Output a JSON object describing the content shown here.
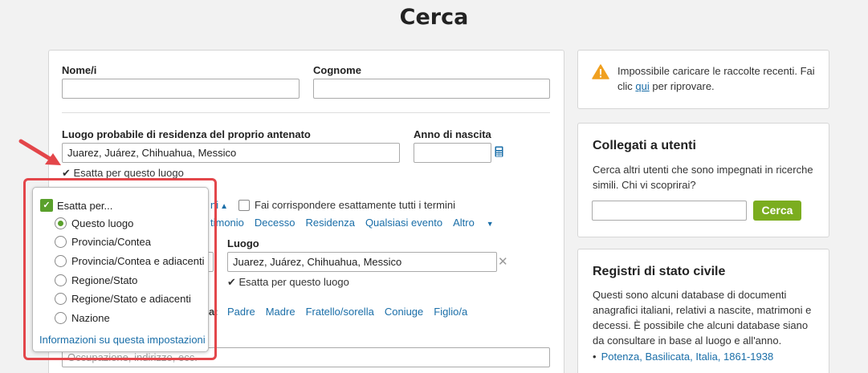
{
  "page": {
    "title": "Cerca"
  },
  "form": {
    "nomi_label": "Nome/i",
    "cognome_label": "Cognome",
    "luogo_label": "Luogo probabile di residenza del proprio antenato",
    "luogo_value": "Juarez, Juárez, Chihuahua, Messico",
    "anno_label": "Anno di nascita",
    "esatta_luogo": "✔ Esatta per questo luogo",
    "match_all": "Fai corrispondere esattamente tutti i termini",
    "collapse_partial": "ni",
    "event_links": [
      "timonio",
      "Decesso",
      "Residenza",
      "Qualsiasi evento"
    ],
    "altro": "Altro",
    "luogo2_label": "Luogo",
    "luogo2_value": "Juarez, Juárez, Chihuahua, Messico",
    "esatta_luogo2": "✔ Esatta per questo luogo",
    "family_partial": "a:",
    "family_links": [
      "Padre",
      "Madre",
      "Fratello/sorella",
      "Coniuge",
      "Figlio/a"
    ],
    "keywords_placeholder": "Occupazione, indirizzo, ecc."
  },
  "popup": {
    "header": "Esatta per...",
    "options": [
      "Questo luogo",
      "Provincia/Contea",
      "Provincia/Contea e adiacenti",
      "Regione/Stato",
      "Regione/Stato e adiacenti",
      "Nazione"
    ],
    "selected": "Questo luogo",
    "info_link": "Informazioni su questa impostazioni"
  },
  "alert": {
    "text_before": "Impossibile caricare le raccolte recenti. Fai clic ",
    "link": "qui",
    "text_after": " per riprovare."
  },
  "connect": {
    "title": "Collegati a utenti",
    "text": "Cerca altri utenti che sono impegnati in ricerche simili. Chi vi scoprirai?",
    "button": "Cerca"
  },
  "registri": {
    "title": "Registri di stato civile",
    "text": "Questi sono alcuni database di documenti anagrafici italiani, relativi a nascite, matrimoni e decessi. È possibile che alcuni database siano da consultare in base al luogo e all'anno.",
    "item": "Potenza, Basilicata, Italia, 1861-1938"
  },
  "colors": {
    "accent_green": "#7bad1f",
    "link_blue": "#1a6ea8",
    "annotation_red": "#e3464a",
    "warning_orange": "#f0a020"
  }
}
